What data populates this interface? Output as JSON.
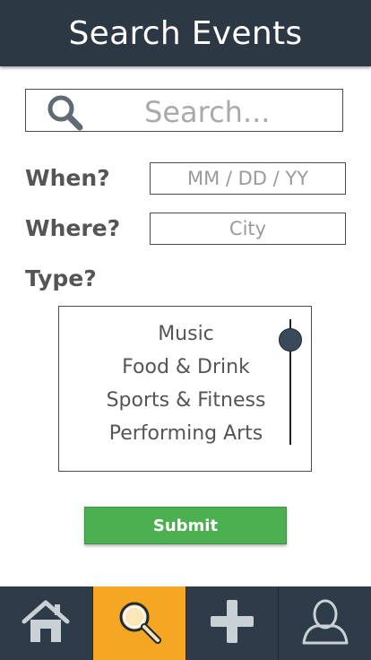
{
  "header": {
    "title": "Search Events"
  },
  "search": {
    "placeholder": "Search..."
  },
  "form": {
    "when": {
      "label": "When?",
      "placeholder": "MM / DD / YY"
    },
    "where": {
      "label": "Where?",
      "placeholder": "City"
    },
    "type": {
      "label": "Type?",
      "options": [
        "Music",
        "Food & Drink",
        "Sports & Fitness",
        "Performing Arts"
      ]
    }
  },
  "submit": {
    "label": "Submit"
  },
  "nav": {
    "items": [
      {
        "icon": "home-icon",
        "active": false
      },
      {
        "icon": "search-icon",
        "active": true
      },
      {
        "icon": "plus-icon",
        "active": false
      },
      {
        "icon": "profile-icon",
        "active": false
      }
    ]
  },
  "colors": {
    "header_bg": "#2c3944",
    "nav_bg": "#2e3b48",
    "nav_active": "#f5a623",
    "submit_bg": "#4caf50"
  }
}
